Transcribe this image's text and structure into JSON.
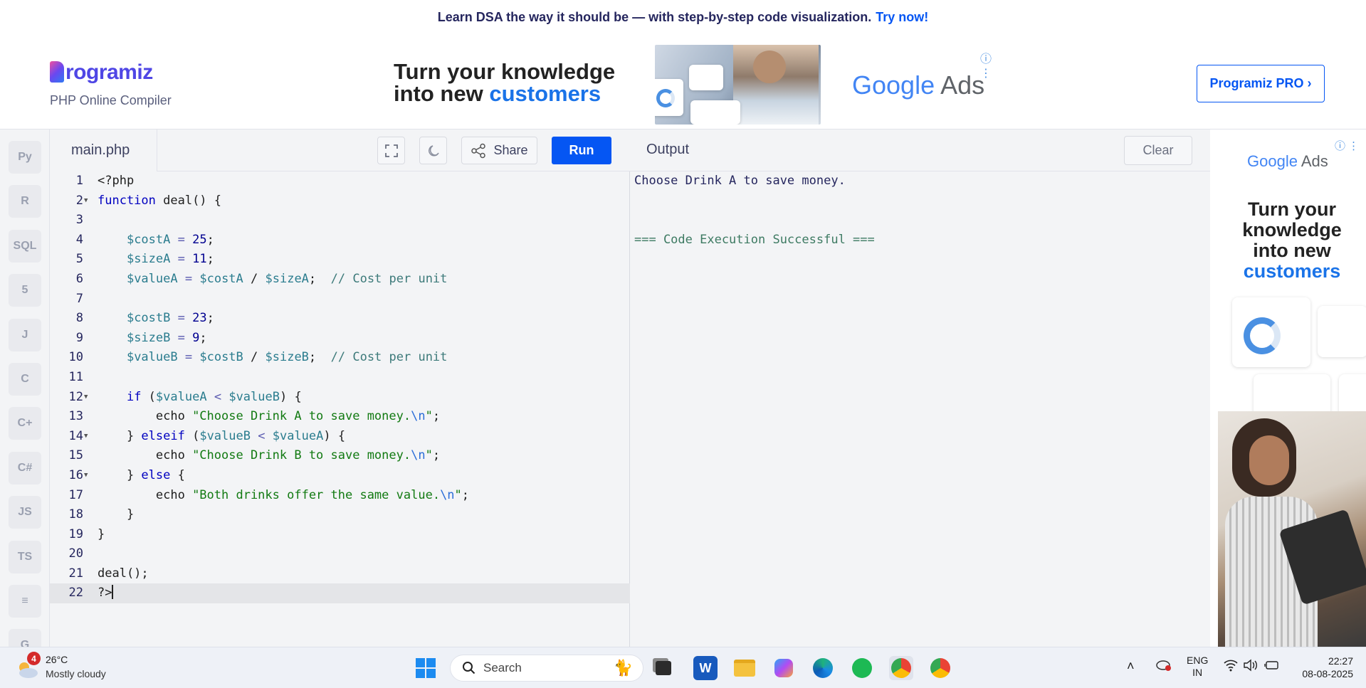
{
  "banner": {
    "text": "Learn DSA the way it should be — with step-by-step code visualization.",
    "link": "Try now!"
  },
  "brand": {
    "name": "rogramiz",
    "subtitle": "PHP Online Compiler"
  },
  "ad_top": {
    "line1": "Turn your knowledge",
    "line2a": "into new ",
    "line2b": "customers",
    "google": "Google",
    "ads": "Ads"
  },
  "pro_button": "Programiz PRO ›",
  "sidebar": {
    "items": [
      {
        "icon": "python-icon",
        "label": "Py"
      },
      {
        "icon": "r-icon",
        "label": "R"
      },
      {
        "icon": "sql-icon",
        "label": "SQL"
      },
      {
        "icon": "html5-icon",
        "label": "5"
      },
      {
        "icon": "java-icon",
        "label": "J"
      },
      {
        "icon": "c-icon",
        "label": "C"
      },
      {
        "icon": "cpp-icon",
        "label": "C+"
      },
      {
        "icon": "csharp-icon",
        "label": "C#"
      },
      {
        "icon": "javascript-icon",
        "label": "JS"
      },
      {
        "icon": "typescript-icon",
        "label": "TS"
      },
      {
        "icon": "swift-icon",
        "label": "≡"
      },
      {
        "icon": "go-icon",
        "label": "G"
      }
    ]
  },
  "editor": {
    "filename": "main.php",
    "share_label": "Share",
    "run_label": "Run",
    "lines": [
      {
        "n": "1",
        "fold": false,
        "html": "&lt;?php"
      },
      {
        "n": "2",
        "fold": true,
        "html": "<span class='kw'>function</span> deal() {"
      },
      {
        "n": "3",
        "fold": false,
        "html": ""
      },
      {
        "n": "4",
        "fold": false,
        "html": "    <span class='var'>$costA</span> <span class='op'>=</span> <span class='num'>25</span>;"
      },
      {
        "n": "5",
        "fold": false,
        "html": "    <span class='var'>$sizeA</span> <span class='op'>=</span> <span class='num'>11</span>;"
      },
      {
        "n": "6",
        "fold": false,
        "html": "    <span class='var'>$valueA</span> <span class='op'>=</span> <span class='var'>$costA</span> / <span class='var'>$sizeA</span>;  <span class='cm'>// Cost per unit</span>"
      },
      {
        "n": "7",
        "fold": false,
        "html": ""
      },
      {
        "n": "8",
        "fold": false,
        "html": "    <span class='var'>$costB</span> <span class='op'>=</span> <span class='num'>23</span>;"
      },
      {
        "n": "9",
        "fold": false,
        "html": "    <span class='var'>$sizeB</span> <span class='op'>=</span> <span class='num'>9</span>;"
      },
      {
        "n": "10",
        "fold": false,
        "html": "    <span class='var'>$valueB</span> <span class='op'>=</span> <span class='var'>$costB</span> / <span class='var'>$sizeB</span>;  <span class='cm'>// Cost per unit</span>"
      },
      {
        "n": "11",
        "fold": false,
        "html": ""
      },
      {
        "n": "12",
        "fold": true,
        "html": "    <span class='kw'>if</span> (<span class='var'>$valueA</span> <span class='op'>&lt;</span> <span class='var'>$valueB</span>) {"
      },
      {
        "n": "13",
        "fold": false,
        "html": "        echo <span class='str'>\"Choose Drink A to save money.</span><span class='esc'>\\n</span><span class='str'>\"</span>;"
      },
      {
        "n": "14",
        "fold": true,
        "html": "    } <span class='kw'>elseif</span> (<span class='var'>$valueB</span> <span class='op'>&lt;</span> <span class='var'>$valueA</span>) {"
      },
      {
        "n": "15",
        "fold": false,
        "html": "        echo <span class='str'>\"Choose Drink B to save money.</span><span class='esc'>\\n</span><span class='str'>\"</span>;"
      },
      {
        "n": "16",
        "fold": true,
        "html": "    } <span class='kw'>else</span> {"
      },
      {
        "n": "17",
        "fold": false,
        "html": "        echo <span class='str'>\"Both drinks offer the same value.</span><span class='esc'>\\n</span><span class='str'>\"</span>;"
      },
      {
        "n": "18",
        "fold": false,
        "html": "    }"
      },
      {
        "n": "19",
        "fold": false,
        "html": "}"
      },
      {
        "n": "20",
        "fold": false,
        "html": ""
      },
      {
        "n": "21",
        "fold": false,
        "html": "deal();"
      },
      {
        "n": "22",
        "fold": false,
        "html": "?&gt;<span class='cursor'></span>",
        "active": true
      }
    ]
  },
  "output": {
    "title": "Output",
    "clear_label": "Clear",
    "lines": [
      "Choose Drink A to save money.",
      "",
      "",
      "=== Code Execution Successful ==="
    ]
  },
  "ad_side": {
    "google": "Google",
    "ads": "Ads",
    "l1": "Turn your",
    "l2": "knowledge",
    "l3": "into new",
    "l4": "customers"
  },
  "taskbar": {
    "weather_temp": "26°C",
    "weather_desc": "Mostly cloudy",
    "weather_badge": "4",
    "search_placeholder": "Search",
    "lang1": "ENG",
    "lang2": "IN",
    "time": "22:27",
    "date": "08-08-2025"
  }
}
